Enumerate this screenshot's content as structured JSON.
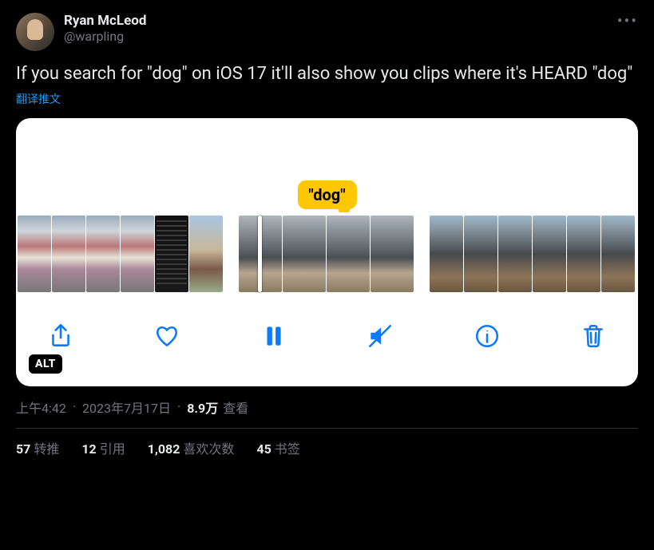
{
  "user": {
    "display_name": "Ryan McLeod",
    "handle": "@warpling"
  },
  "tweet_text": "If you search for \"dog\" on iOS 17 it'll also show you clips where it's HEARD \"dog\"",
  "translate_label": "翻译推文",
  "media": {
    "tooltip": "\"dog\"",
    "alt_badge": "ALT"
  },
  "meta": {
    "time": "上午4:42",
    "date": "2023年7月17日",
    "views_count": "8.9万",
    "views_label": "查看"
  },
  "stats": {
    "retweets_count": "57",
    "retweets_label": "转推",
    "quotes_count": "12",
    "quotes_label": "引用",
    "likes_count": "1,082",
    "likes_label": "喜欢次数",
    "bookmarks_count": "45",
    "bookmarks_label": "书签"
  }
}
